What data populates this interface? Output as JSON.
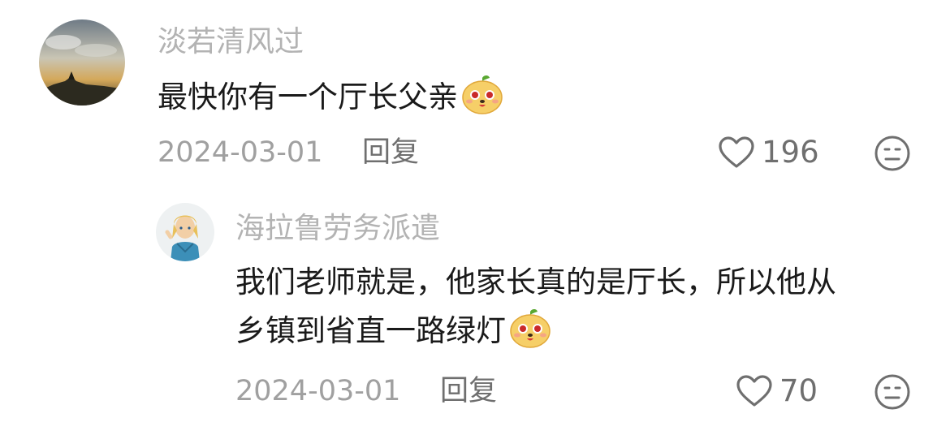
{
  "comments": [
    {
      "username": "淡若清风过",
      "text": "最快你有一个厅长父亲",
      "emoji": "dog-face-emoji",
      "date": "2024-03-01",
      "reply_label": "回复",
      "likes": "196"
    }
  ],
  "replies": [
    {
      "username": "海拉鲁劳务派遣",
      "text_line1": "我们老师就是，他家长真的是厅长，所以他从",
      "text_line2": "乡镇到省直一路绿灯",
      "emoji": "dog-face-emoji",
      "date": "2024-03-01",
      "reply_label": "回复",
      "likes": "70"
    }
  ],
  "icons": {
    "like": "heart-outline-icon",
    "dislike": "neutral-face-icon"
  }
}
